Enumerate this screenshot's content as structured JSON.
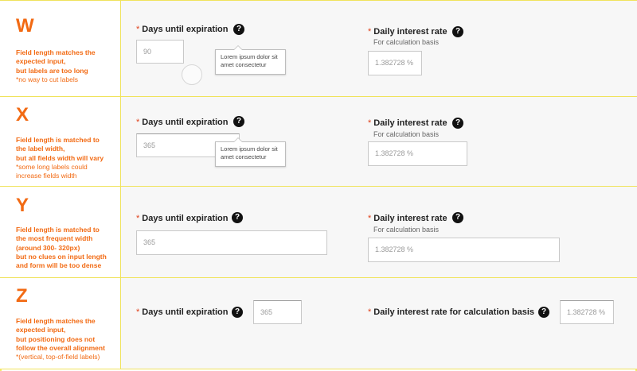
{
  "common": {
    "days_label": "Days until expiration",
    "rate_label": "Daily interest rate",
    "rate_sublabel": "For calculation basis",
    "required_mark": "*",
    "help_glyph": "?",
    "tooltip_text": "Lorem ipsum dolor sit amet consectetur"
  },
  "rows": {
    "w": {
      "letter": "W",
      "desc_bold": [
        "Field length matches the",
        "expected input,",
        "but labels are too long"
      ],
      "desc_note": [
        "*no way to cut labels"
      ],
      "days_value": "90",
      "rate_value": "1.382728 %"
    },
    "x": {
      "letter": "X",
      "desc_bold": [
        "Field length is matched to",
        "the label width,",
        "but all fields width will vary"
      ],
      "desc_note": [
        "*some long labels could",
        "increase fields width"
      ],
      "days_value": "365",
      "rate_value": "1.382728 %"
    },
    "y": {
      "letter": "Y",
      "desc_bold": [
        "Field length is matched to",
        "the most frequent width",
        "(around 300- 320px)",
        "but no clues on input length",
        "and form will be too dense"
      ],
      "desc_note": [],
      "days_value": "365",
      "rate_value": "1.382728 %"
    },
    "z": {
      "letter": "Z",
      "desc_bold": [
        "Field length matches the",
        "expected input,",
        "but positioning does not",
        "follow the overall alignment"
      ],
      "desc_note": [
        "*(vertical, top-of-field labels)"
      ],
      "days_value": "365",
      "rate_label_long": "Daily interest rate for calculation basis",
      "rate_value": "1.382728 %"
    }
  },
  "colors": {
    "accent_orange": "#f26a13",
    "required_red": "#e0401a",
    "guide_yellow": "#f0e35c",
    "panel_gray": "#f7f7f7"
  }
}
